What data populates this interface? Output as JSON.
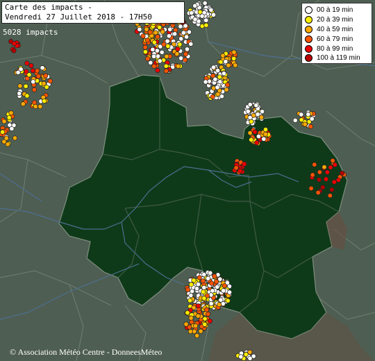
{
  "title": {
    "line1": "Carte des impacts -",
    "line2": "Vendredi 27 Juillet 2018 - 17H50"
  },
  "impact_count": "5028 impacts",
  "legend": [
    {
      "label": "00 à 19 min",
      "color": "#ffffff"
    },
    {
      "label": "20 à 39 min",
      "color": "#ffee00"
    },
    {
      "label": "40 à 59 min",
      "color": "#ffaa00"
    },
    {
      "label": "60 à 79 min",
      "color": "#ff5500"
    },
    {
      "label": "80 à 99 min",
      "color": "#ee0000"
    },
    {
      "label": "100 à 119 min",
      "color": "#b80000"
    }
  ],
  "copyright": "© Association Météo Centre - DonneesMéteo",
  "colors": {
    "background": "#4f5e52",
    "region_fill": "#0f3a19",
    "region_border": "#7d8f7f",
    "river": "#4b6f91"
  }
}
